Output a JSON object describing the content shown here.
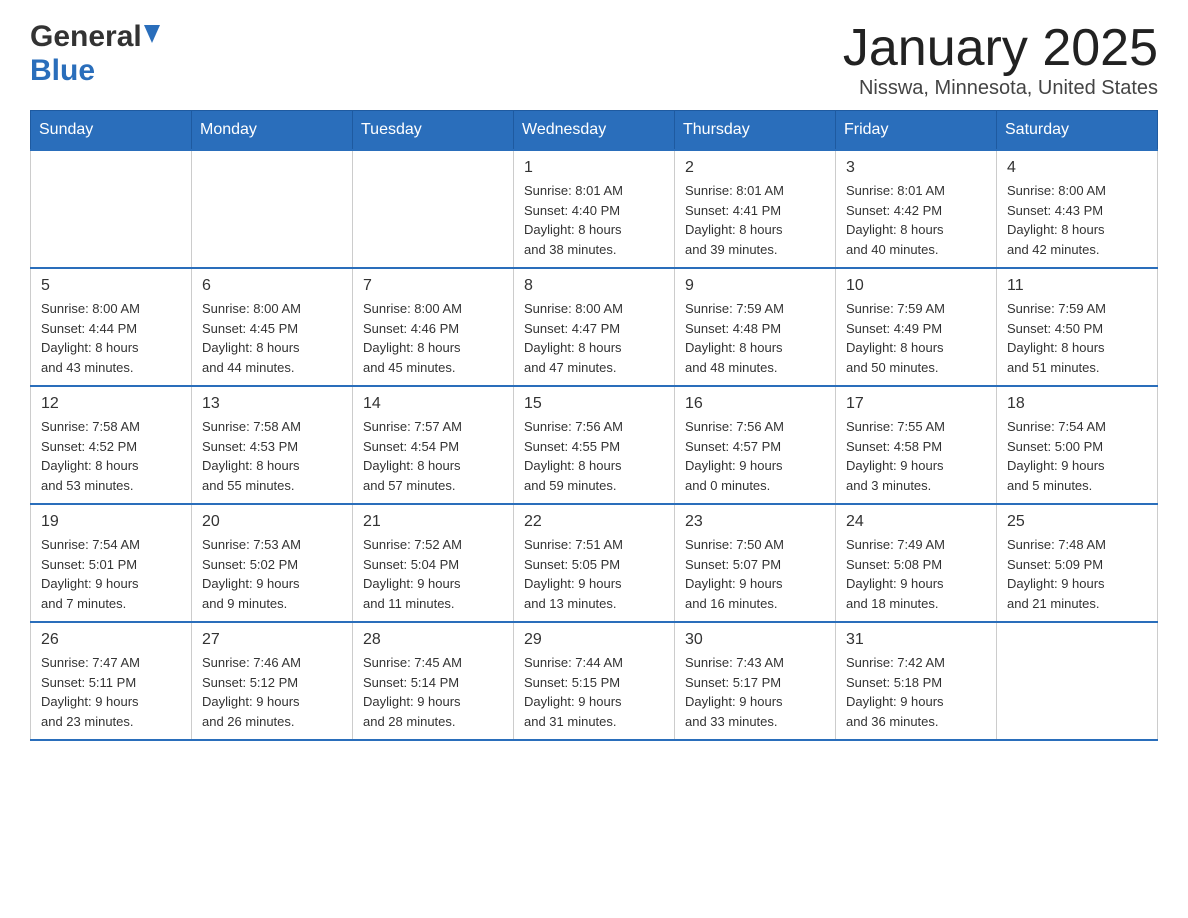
{
  "header": {
    "logo_general": "General",
    "logo_blue": "Blue",
    "title": "January 2025",
    "location": "Nisswa, Minnesota, United States"
  },
  "weekdays": [
    "Sunday",
    "Monday",
    "Tuesday",
    "Wednesday",
    "Thursday",
    "Friday",
    "Saturday"
  ],
  "weeks": [
    [
      {
        "day": "",
        "info": ""
      },
      {
        "day": "",
        "info": ""
      },
      {
        "day": "",
        "info": ""
      },
      {
        "day": "1",
        "info": "Sunrise: 8:01 AM\nSunset: 4:40 PM\nDaylight: 8 hours\nand 38 minutes."
      },
      {
        "day": "2",
        "info": "Sunrise: 8:01 AM\nSunset: 4:41 PM\nDaylight: 8 hours\nand 39 minutes."
      },
      {
        "day": "3",
        "info": "Sunrise: 8:01 AM\nSunset: 4:42 PM\nDaylight: 8 hours\nand 40 minutes."
      },
      {
        "day": "4",
        "info": "Sunrise: 8:00 AM\nSunset: 4:43 PM\nDaylight: 8 hours\nand 42 minutes."
      }
    ],
    [
      {
        "day": "5",
        "info": "Sunrise: 8:00 AM\nSunset: 4:44 PM\nDaylight: 8 hours\nand 43 minutes."
      },
      {
        "day": "6",
        "info": "Sunrise: 8:00 AM\nSunset: 4:45 PM\nDaylight: 8 hours\nand 44 minutes."
      },
      {
        "day": "7",
        "info": "Sunrise: 8:00 AM\nSunset: 4:46 PM\nDaylight: 8 hours\nand 45 minutes."
      },
      {
        "day": "8",
        "info": "Sunrise: 8:00 AM\nSunset: 4:47 PM\nDaylight: 8 hours\nand 47 minutes."
      },
      {
        "day": "9",
        "info": "Sunrise: 7:59 AM\nSunset: 4:48 PM\nDaylight: 8 hours\nand 48 minutes."
      },
      {
        "day": "10",
        "info": "Sunrise: 7:59 AM\nSunset: 4:49 PM\nDaylight: 8 hours\nand 50 minutes."
      },
      {
        "day": "11",
        "info": "Sunrise: 7:59 AM\nSunset: 4:50 PM\nDaylight: 8 hours\nand 51 minutes."
      }
    ],
    [
      {
        "day": "12",
        "info": "Sunrise: 7:58 AM\nSunset: 4:52 PM\nDaylight: 8 hours\nand 53 minutes."
      },
      {
        "day": "13",
        "info": "Sunrise: 7:58 AM\nSunset: 4:53 PM\nDaylight: 8 hours\nand 55 minutes."
      },
      {
        "day": "14",
        "info": "Sunrise: 7:57 AM\nSunset: 4:54 PM\nDaylight: 8 hours\nand 57 minutes."
      },
      {
        "day": "15",
        "info": "Sunrise: 7:56 AM\nSunset: 4:55 PM\nDaylight: 8 hours\nand 59 minutes."
      },
      {
        "day": "16",
        "info": "Sunrise: 7:56 AM\nSunset: 4:57 PM\nDaylight: 9 hours\nand 0 minutes."
      },
      {
        "day": "17",
        "info": "Sunrise: 7:55 AM\nSunset: 4:58 PM\nDaylight: 9 hours\nand 3 minutes."
      },
      {
        "day": "18",
        "info": "Sunrise: 7:54 AM\nSunset: 5:00 PM\nDaylight: 9 hours\nand 5 minutes."
      }
    ],
    [
      {
        "day": "19",
        "info": "Sunrise: 7:54 AM\nSunset: 5:01 PM\nDaylight: 9 hours\nand 7 minutes."
      },
      {
        "day": "20",
        "info": "Sunrise: 7:53 AM\nSunset: 5:02 PM\nDaylight: 9 hours\nand 9 minutes."
      },
      {
        "day": "21",
        "info": "Sunrise: 7:52 AM\nSunset: 5:04 PM\nDaylight: 9 hours\nand 11 minutes."
      },
      {
        "day": "22",
        "info": "Sunrise: 7:51 AM\nSunset: 5:05 PM\nDaylight: 9 hours\nand 13 minutes."
      },
      {
        "day": "23",
        "info": "Sunrise: 7:50 AM\nSunset: 5:07 PM\nDaylight: 9 hours\nand 16 minutes."
      },
      {
        "day": "24",
        "info": "Sunrise: 7:49 AM\nSunset: 5:08 PM\nDaylight: 9 hours\nand 18 minutes."
      },
      {
        "day": "25",
        "info": "Sunrise: 7:48 AM\nSunset: 5:09 PM\nDaylight: 9 hours\nand 21 minutes."
      }
    ],
    [
      {
        "day": "26",
        "info": "Sunrise: 7:47 AM\nSunset: 5:11 PM\nDaylight: 9 hours\nand 23 minutes."
      },
      {
        "day": "27",
        "info": "Sunrise: 7:46 AM\nSunset: 5:12 PM\nDaylight: 9 hours\nand 26 minutes."
      },
      {
        "day": "28",
        "info": "Sunrise: 7:45 AM\nSunset: 5:14 PM\nDaylight: 9 hours\nand 28 minutes."
      },
      {
        "day": "29",
        "info": "Sunrise: 7:44 AM\nSunset: 5:15 PM\nDaylight: 9 hours\nand 31 minutes."
      },
      {
        "day": "30",
        "info": "Sunrise: 7:43 AM\nSunset: 5:17 PM\nDaylight: 9 hours\nand 33 minutes."
      },
      {
        "day": "31",
        "info": "Sunrise: 7:42 AM\nSunset: 5:18 PM\nDaylight: 9 hours\nand 36 minutes."
      },
      {
        "day": "",
        "info": ""
      }
    ]
  ]
}
